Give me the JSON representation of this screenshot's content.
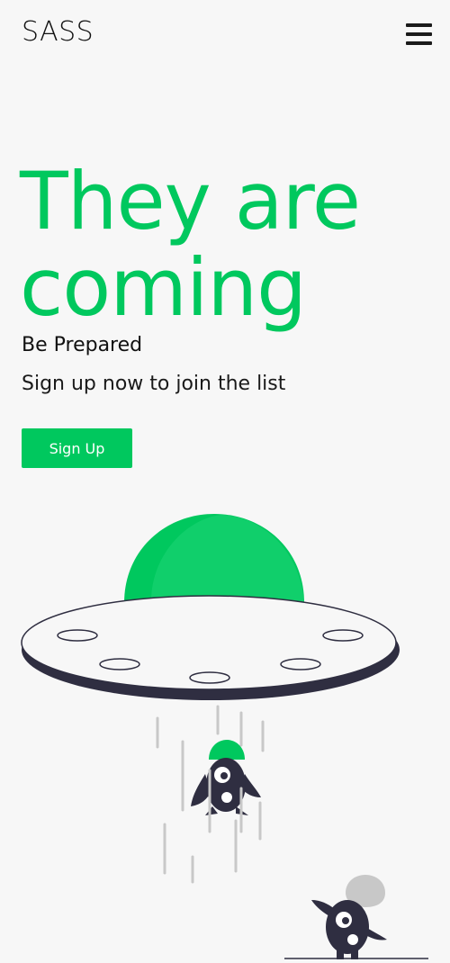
{
  "header": {
    "logo": "SASS",
    "menu_icon": "hamburger-menu-icon"
  },
  "hero": {
    "title": "They are coming",
    "tagline": "Be Prepared",
    "subline": "Sign up now to join the list",
    "cta_label": "Sign Up"
  },
  "illustration": {
    "name": "ufo-abduction-illustration"
  },
  "colors": {
    "accent": "#00c85e",
    "accent_light": "#1ed676",
    "dark": "#2f2e41",
    "background": "#f7f7f7",
    "text": "#111111"
  }
}
